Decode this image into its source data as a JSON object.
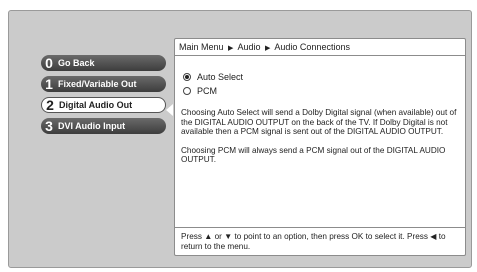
{
  "menu": {
    "items": [
      {
        "number": "0",
        "label": "Go Back",
        "active": false
      },
      {
        "number": "1",
        "label": "Fixed/Variable Out",
        "active": false
      },
      {
        "number": "2",
        "label": "Digital Audio Out",
        "active": true
      },
      {
        "number": "3",
        "label": "DVI Audio Input",
        "active": false
      }
    ]
  },
  "panel": {
    "breadcrumb": [
      "Main Menu",
      "Audio",
      "Audio Connections"
    ],
    "breadcrumb_separator": "▶",
    "options": [
      {
        "label": "Auto Select",
        "selected": true
      },
      {
        "label": "PCM",
        "selected": false
      }
    ],
    "description": [
      "Choosing Auto Select will send a Dolby Digital signal (when available) out of the DIGITAL AUDIO OUTPUT on the back of the TV. If Dolby Digital is not available then a PCM signal is sent out of the DIGITAL AUDIO OUTPUT.",
      "Choosing PCM will always send a PCM signal out of the DIGITAL AUDIO OUTPUT."
    ],
    "footer": "Press ▲ or ▼ to point to an option, then press OK to select it. Press ◀ to return to the menu."
  },
  "colors": {
    "background": "#cbcbcb",
    "menu_button": "#4a4a4a",
    "panel": "#ffffff"
  }
}
